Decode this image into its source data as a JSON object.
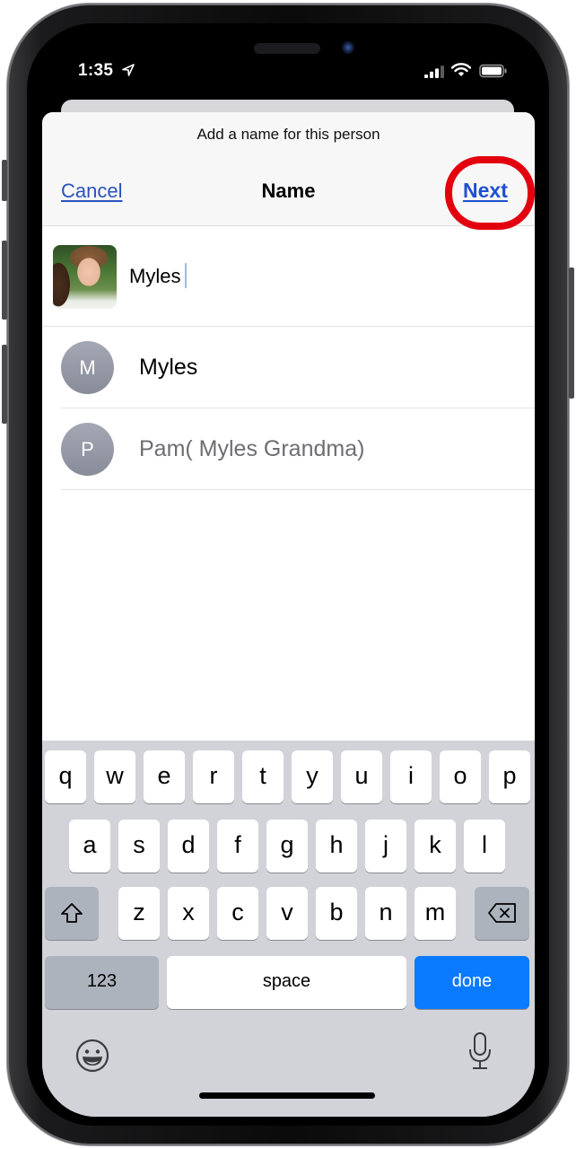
{
  "status_bar": {
    "time": "1:35",
    "location_icon": "location-arrow-icon",
    "signal_bars": 3,
    "signal_bars_total": 4,
    "wifi_icon": "wifi-icon",
    "battery_level_percent": 100
  },
  "sheet": {
    "prompt": "Add a name for this person",
    "nav": {
      "cancel_label": "Cancel",
      "title": "Name",
      "next_label": "Next"
    },
    "highlight_color": "#e3000f",
    "name_field": {
      "value": "Myles",
      "placeholder": ""
    },
    "suggestions": [
      {
        "initial": "M",
        "label": "Myles"
      },
      {
        "initial": "P",
        "label": "Pam( Myles Grandma)"
      }
    ]
  },
  "keyboard": {
    "row1": [
      "q",
      "w",
      "e",
      "r",
      "t",
      "y",
      "u",
      "i",
      "o",
      "p"
    ],
    "row2": [
      "a",
      "s",
      "d",
      "f",
      "g",
      "h",
      "j",
      "k",
      "l"
    ],
    "row3": [
      "z",
      "x",
      "c",
      "v",
      "b",
      "n",
      "m"
    ],
    "shift_icon": "shift-icon",
    "delete_icon": "delete-backspace-icon",
    "numbers_label": "123",
    "space_label": "space",
    "done_label": "done",
    "done_color": "#0a7aff",
    "emoji_icon": "emoji-icon",
    "mic_icon": "microphone-icon"
  }
}
